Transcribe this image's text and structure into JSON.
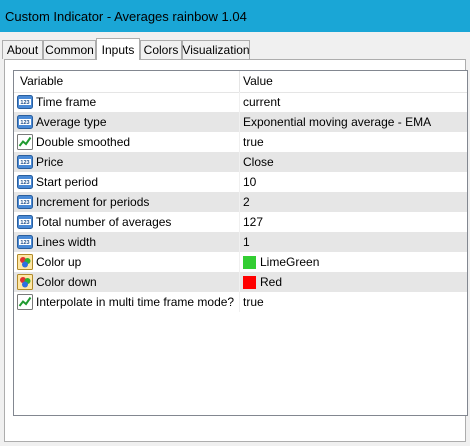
{
  "window": {
    "title": "Custom Indicator - Averages rainbow 1.04"
  },
  "tabs": [
    {
      "label": "About"
    },
    {
      "label": "Common"
    },
    {
      "label": "Inputs"
    },
    {
      "label": "Colors"
    },
    {
      "label": "Visualization"
    }
  ],
  "active_tab": "Inputs",
  "grid": {
    "headers": {
      "variable": "Variable",
      "value": "Value"
    },
    "rows": [
      {
        "label": "Time frame",
        "value": "current",
        "icon": "numeric-123-icon"
      },
      {
        "label": "Average type",
        "value": "Exponential moving average - EMA",
        "icon": "numeric-123-icon"
      },
      {
        "label": "Double smoothed",
        "value": "true",
        "icon": "boolean-chart-icon"
      },
      {
        "label": "Price",
        "value": "Close",
        "icon": "numeric-123-icon"
      },
      {
        "label": "Start period",
        "value": "10",
        "icon": "numeric-123-icon"
      },
      {
        "label": "Increment for periods",
        "value": "2",
        "icon": "numeric-123-icon"
      },
      {
        "label": "Total number of averages",
        "value": "127",
        "icon": "numeric-123-icon"
      },
      {
        "label": "Lines width",
        "value": "1",
        "icon": "numeric-123-icon"
      },
      {
        "label": "Color up",
        "value": "LimeGreen",
        "icon": "color-icon",
        "swatch": "#32cd32"
      },
      {
        "label": "Color down",
        "value": "Red",
        "icon": "color-icon",
        "swatch": "#ff0000"
      },
      {
        "label": "Interpolate in multi time frame mode?",
        "value": "true",
        "icon": "boolean-chart-icon"
      }
    ]
  },
  "colors": {
    "titlebar": "#1aa6d6",
    "row_alt": "#e6e6e6"
  }
}
